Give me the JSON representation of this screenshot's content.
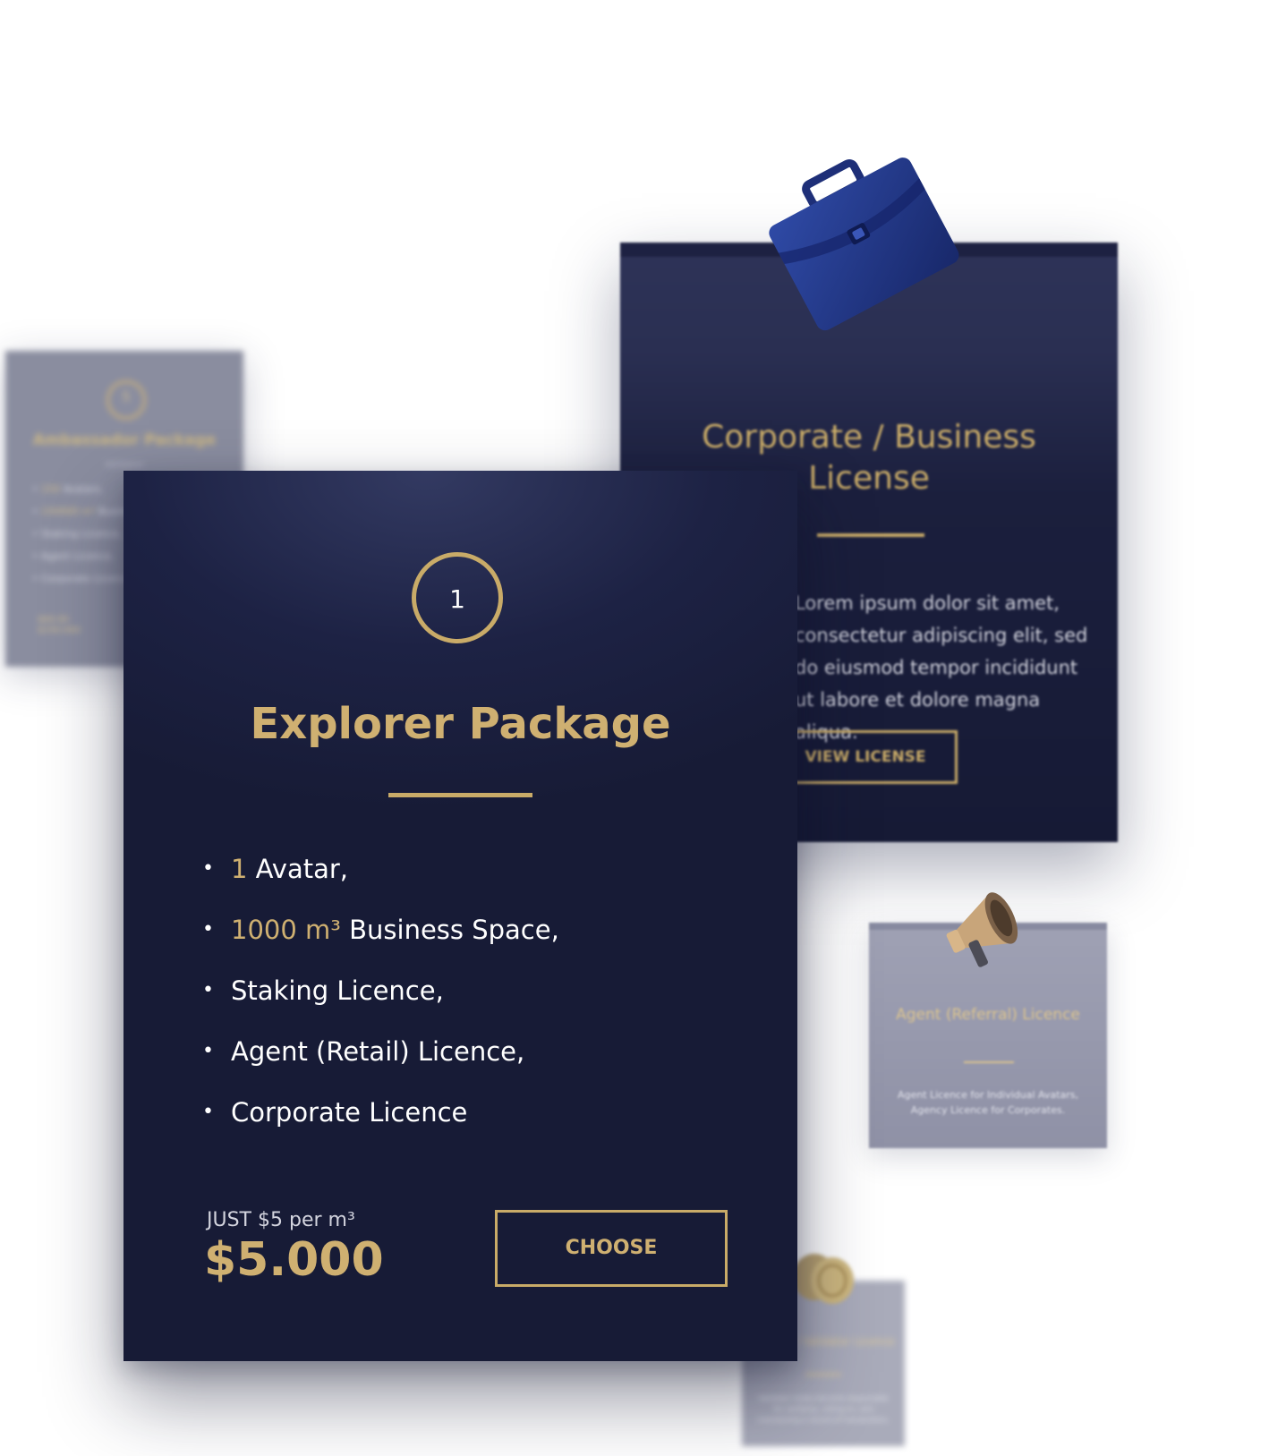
{
  "ambassador": {
    "number": "5",
    "title": "Ambassador Package",
    "subtitle": "Validator",
    "items": [
      {
        "hl": "150",
        "text": " Avatars,"
      },
      {
        "hl": "150000 m³",
        "text": " Business"
      },
      {
        "hl": "",
        "text": "Staking Licence,"
      },
      {
        "hl": "",
        "text": "Agent Licence,"
      },
      {
        "hl": "",
        "text": "Corporate Licence"
      }
    ],
    "price_label": "$60.00 $150.000"
  },
  "corporate": {
    "title": "Corporate / Business License",
    "body": "Lorem ipsum dolor sit amet, consectetur adipiscing elit, sed do eiusmod tempor incididunt ut labore et dolore magna aliqua.",
    "button": "VIEW LICENSE",
    "icon": "briefcase-icon"
  },
  "agent": {
    "title": "Agent (Referral) Licence",
    "body": "Agent Licence for Individual Avatars, Agency Licence for Corporates.",
    "icon": "megaphone-icon"
  },
  "staking": {
    "title": "Staking / Validator Licence",
    "body": "Validator nodes become responsible for verifying, voting on, and maintaining a record of transactions.",
    "icon": "coins-icon"
  },
  "explorer": {
    "number": "1",
    "title": "Explorer Package",
    "items": [
      {
        "hl": "1",
        "text": " Avatar,"
      },
      {
        "hl": "1000 m³",
        "text": " Business Space,"
      },
      {
        "hl": "",
        "text": "Staking Licence,"
      },
      {
        "hl": "",
        "text": "Agent (Retail) Licence,"
      },
      {
        "hl": "",
        "text": "Corporate Licence"
      }
    ],
    "per_unit": "JUST $5 per m³",
    "price": "$5.000",
    "button": "CHOOSE"
  },
  "colors": {
    "gold": "#c9ab68",
    "navy": "#171b36"
  }
}
